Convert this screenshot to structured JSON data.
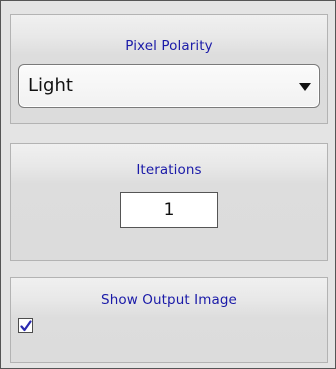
{
  "polarity": {
    "title": "Pixel Polarity",
    "selected": "Light"
  },
  "iterations": {
    "title": "Iterations",
    "value": "1"
  },
  "output": {
    "title": "Show Output Image",
    "checked": true
  },
  "colors": {
    "title_text": "#1a1aa8",
    "checkmark": "#2a2ab0",
    "panel_bg": "#e4e4e4"
  },
  "icons": {
    "dropdown": "triangle-down-icon",
    "checkbox": "checkmark-icon"
  }
}
